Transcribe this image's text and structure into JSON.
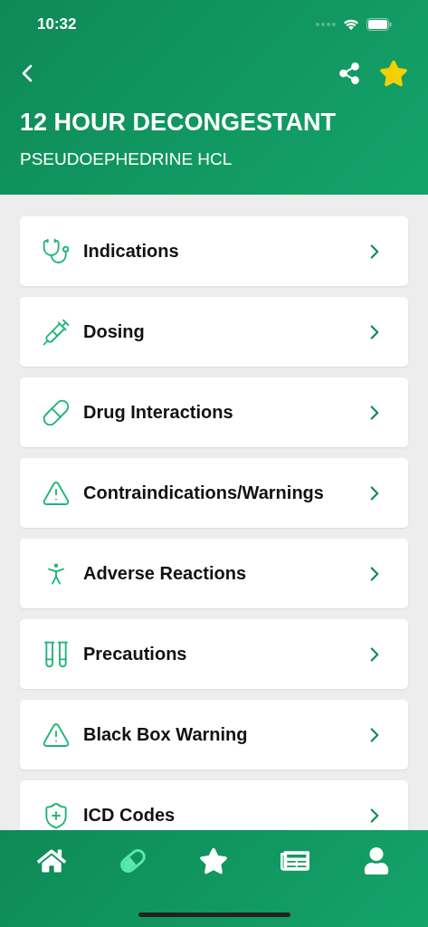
{
  "status_bar": {
    "time": "10:32"
  },
  "header": {
    "favorited": true,
    "title": "12 HOUR DECONGESTANT",
    "subtitle": "PSEUDOEPHEDRINE HCL"
  },
  "sections": [
    {
      "label": "Indications"
    },
    {
      "label": "Dosing"
    },
    {
      "label": "Drug Interactions"
    },
    {
      "label": "Contraindications/Warnings"
    },
    {
      "label": "Adverse Reactions"
    },
    {
      "label": "Precautions"
    },
    {
      "label": "Black Box Warning"
    },
    {
      "label": "ICD Codes"
    }
  ],
  "tab_bar": [
    {
      "selected": false
    },
    {
      "selected": true
    },
    {
      "selected": false
    },
    {
      "selected": false
    },
    {
      "selected": false
    }
  ]
}
